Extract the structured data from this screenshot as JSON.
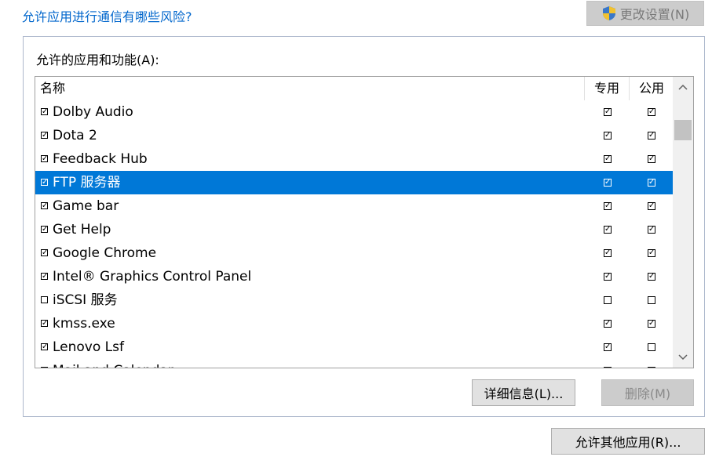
{
  "risk_link": "允许应用进行通信有哪些风险?",
  "change_settings_label": "更改设置(N)",
  "allowed_label": "允许的应用和功能(A):",
  "columns": {
    "name": "名称",
    "private": "专用",
    "public": "公用"
  },
  "apps": [
    {
      "name": "Dolby Audio",
      "enabled": true,
      "private": true,
      "public": true
    },
    {
      "name": "Dota 2",
      "enabled": true,
      "private": true,
      "public": true
    },
    {
      "name": "Feedback Hub",
      "enabled": true,
      "private": true,
      "public": true
    },
    {
      "name": "FTP 服务器",
      "enabled": true,
      "private": true,
      "public": true,
      "selected": true
    },
    {
      "name": "Game bar",
      "enabled": true,
      "private": true,
      "public": true
    },
    {
      "name": "Get Help",
      "enabled": true,
      "private": true,
      "public": true
    },
    {
      "name": "Google Chrome",
      "enabled": true,
      "private": true,
      "public": true
    },
    {
      "name": "Intel® Graphics Control Panel",
      "enabled": true,
      "private": true,
      "public": true
    },
    {
      "name": "iSCSI 服务",
      "enabled": false,
      "private": false,
      "public": false
    },
    {
      "name": "kmss.exe",
      "enabled": true,
      "private": true,
      "public": true
    },
    {
      "name": "Lenovo Lsf",
      "enabled": true,
      "private": true,
      "public": false
    },
    {
      "name": "Mail and Calendar",
      "enabled": true,
      "private": true,
      "public": true
    }
  ],
  "details_button": "详细信息(L)...",
  "remove_button": "删除(M)",
  "allow_other_button": "允许其他应用(R)...",
  "icons": {
    "shield": "uac-shield-icon",
    "up": "chevron-up-icon",
    "down": "chevron-down-icon"
  }
}
